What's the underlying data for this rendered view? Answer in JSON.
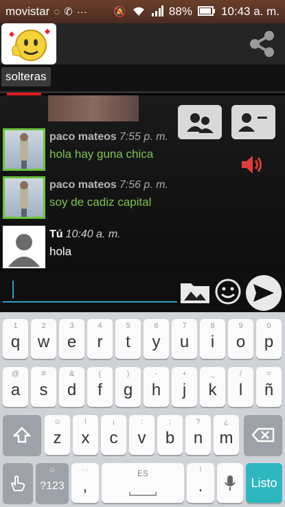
{
  "status_bar": {
    "carrier": "movistar",
    "battery": "88%",
    "time": "10:43 a. m."
  },
  "tab": {
    "label": "solteras"
  },
  "messages": [
    {
      "name": "paco mateos",
      "time": "7:55 p. m.",
      "text": "hola hay guna chica"
    },
    {
      "name": "paco mateos",
      "time": "7:56 p. m.",
      "text": "soy de cadiz capital"
    },
    {
      "name": "Tú",
      "time": "10:40 a. m.",
      "text": "hola"
    }
  ],
  "composer": {
    "placeholder": ""
  },
  "keyboard": {
    "row1": [
      {
        "sec": "1",
        "main": "q"
      },
      {
        "sec": "2",
        "main": "w"
      },
      {
        "sec": "3",
        "main": "e"
      },
      {
        "sec": "4",
        "main": "r"
      },
      {
        "sec": "5",
        "main": "t"
      },
      {
        "sec": "6",
        "main": "y"
      },
      {
        "sec": "7",
        "main": "u"
      },
      {
        "sec": "8",
        "main": "i"
      },
      {
        "sec": "9",
        "main": "o"
      },
      {
        "sec": "0",
        "main": "p"
      }
    ],
    "row2": [
      {
        "sec": "@",
        "main": "a"
      },
      {
        "sec": "#",
        "main": "s"
      },
      {
        "sec": "&",
        "main": "d"
      },
      {
        "sec": "(",
        "main": "f"
      },
      {
        "sec": ")",
        "main": "g"
      },
      {
        "sec": "-",
        "main": "h"
      },
      {
        "sec": "+",
        "main": "j"
      },
      {
        "sec": "_",
        "main": "k"
      },
      {
        "sec": "/",
        "main": "l"
      },
      {
        "sec": "=",
        "main": "ñ"
      }
    ],
    "row3": [
      {
        "sec": "☺",
        "main": "z"
      },
      {
        "sec": "!",
        "main": "x"
      },
      {
        "sec": "¡",
        "main": "c"
      },
      {
        "sec": ":",
        "main": "v"
      },
      {
        "sec": ";",
        "main": "b"
      },
      {
        "sec": "?",
        "main": "n"
      },
      {
        "sec": "¿",
        "main": "m"
      }
    ],
    "num_label": "?123",
    "comma": ",",
    "space_label": "ES",
    "period": ".",
    "listo_label": "Listo"
  }
}
